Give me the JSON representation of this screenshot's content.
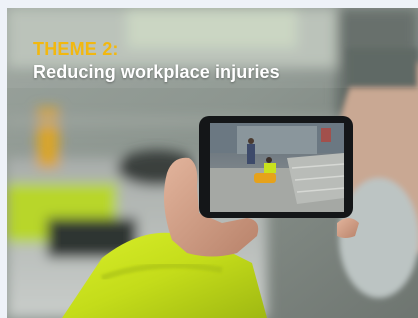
{
  "theme": {
    "label": "THEME 2:",
    "title": "Reducing workplace injuries"
  },
  "colors": {
    "label_accent": "#f2b80f",
    "title_text": "#ffffff",
    "page_background": "#eef2f8",
    "hi_vis_yellow": "#c7e21a"
  },
  "image": {
    "subject": "hand-holding-smartphone-photo"
  }
}
